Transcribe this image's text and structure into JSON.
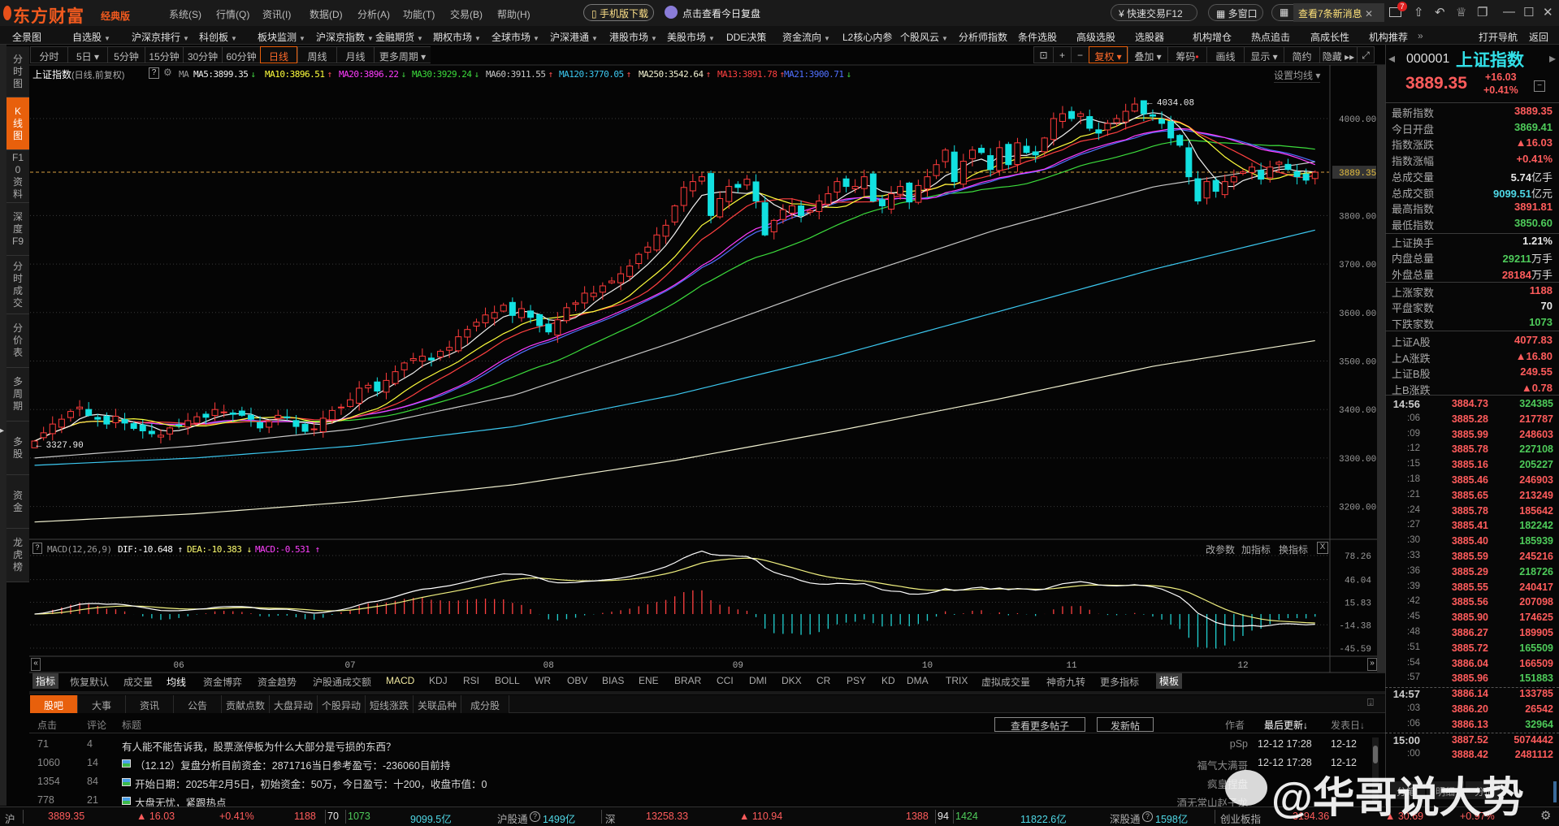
{
  "app": {
    "logo": "东方财富",
    "edition": "经典版",
    "menu": [
      "系统(S)",
      "行情(Q)",
      "资讯(I)",
      "数据(D)",
      "分析(A)",
      "功能(T)",
      "交易(B)",
      "帮助(H)"
    ],
    "mobile_download": "手机版下载",
    "daily_review": "点击查看今日复盘",
    "quick_trade": "快速交易F12",
    "multi_window": "多窗口",
    "new_messages": "查看7条新消息",
    "message_badge": "7"
  },
  "nav": {
    "items": [
      {
        "label": "全景图",
        "dropdown": false
      },
      {
        "label": "自选股",
        "dropdown": true
      },
      {
        "label": "沪深京排行",
        "dropdown": true
      },
      {
        "label": "科创板",
        "dropdown": true
      },
      {
        "label": "板块监测",
        "dropdown": true
      },
      {
        "label": "沪深京指数",
        "dropdown": true
      },
      {
        "label": "金融期货",
        "dropdown": true
      },
      {
        "label": "期权市场",
        "dropdown": true
      },
      {
        "label": "全球市场",
        "dropdown": true
      },
      {
        "label": "沪深港通",
        "dropdown": true
      },
      {
        "label": "港股市场",
        "dropdown": true
      },
      {
        "label": "美股市场",
        "dropdown": true
      },
      {
        "label": "DDE决策",
        "dropdown": false
      },
      {
        "label": "资金流向",
        "dropdown": true
      },
      {
        "label": "L2核心内参",
        "dropdown": false
      },
      {
        "label": "个股风云",
        "dropdown": true
      },
      {
        "label": "分析师指数",
        "dropdown": false
      },
      {
        "label": "条件选股",
        "dropdown": false
      },
      {
        "label": "高级选股",
        "dropdown": false
      },
      {
        "label": "选股器",
        "dropdown": false
      },
      {
        "label": "机构增仓",
        "dropdown": false
      },
      {
        "label": "热点追击",
        "dropdown": false
      },
      {
        "label": "高成长性",
        "dropdown": false
      },
      {
        "label": "机构推荐",
        "dropdown": false
      }
    ],
    "more": "»",
    "open_nav": "打开导航",
    "back": "返回"
  },
  "sidebar": [
    "分时图",
    "K线图",
    "F10资料",
    "深度F9",
    "分时成交",
    "分价表",
    "多周期",
    "多股",
    "资金",
    "龙虎榜"
  ],
  "sidebar_active": 1,
  "periods": {
    "items": [
      "分时",
      "5日 ▾",
      "5分钟",
      "15分钟",
      "30分钟",
      "60分钟",
      "日线",
      "周线",
      "月线",
      "更多周期 ▾"
    ],
    "active": 6
  },
  "toolbar": {
    "items": [
      "复权 ▾",
      "叠加 ▾",
      "筹码",
      "画线",
      "显示 ▾",
      "简约",
      "隐藏 ▸▸"
    ],
    "active": 0
  },
  "legend": {
    "name": "上证指数",
    "mode": "(日线,前复权)",
    "help": "?",
    "ma_label": "MA",
    "items": [
      {
        "label": "MA5:3899.35",
        "arrow": "↓",
        "color": "#f0f0f0"
      },
      {
        "label": "MA10:3896.51",
        "arrow": "↑",
        "color": "#ffff3c"
      },
      {
        "label": "MA20:3896.22",
        "arrow": "↓",
        "color": "#ff3cff"
      },
      {
        "label": "MA30:3929.24",
        "arrow": "↓",
        "color": "#3cdc3c"
      },
      {
        "label": "MA60:3911.55",
        "arrow": "↑",
        "color": "#c8c8c8"
      },
      {
        "label": "MA120:3770.05",
        "arrow": "↑",
        "color": "#3cc8f0"
      },
      {
        "label": "MA250:3542.64",
        "arrow": "↑",
        "color": "#f0f0d0"
      },
      {
        "label": "MA13:3891.78",
        "arrow": "↑",
        "color": "#ff4040"
      },
      {
        "label": "MA21:3900.71",
        "arrow": "↓",
        "color": "#5070ff"
      }
    ],
    "set_ma": "设置均线 ▾"
  },
  "chart_data": {
    "type": "candlestick",
    "title": "上证指数 日线",
    "close": [
      3335,
      3352,
      3370,
      3380,
      3396,
      3405,
      3388,
      3380,
      3370,
      3386,
      3372,
      3361,
      3356,
      3350,
      3347,
      3362,
      3368,
      3377,
      3385,
      3384,
      3400,
      3395,
      3390,
      3388,
      3380,
      3362,
      3375,
      3388,
      3383,
      3365,
      3355,
      3360,
      3382,
      3398,
      3405,
      3420,
      3444,
      3450,
      3438,
      3460,
      3478,
      3496,
      3505,
      3510,
      3502,
      3520,
      3528,
      3550,
      3565,
      3580,
      3595,
      3600,
      3615,
      3594,
      3608,
      3590,
      3573,
      3560,
      3585,
      3610,
      3620,
      3640,
      3640,
      3655,
      3665,
      3680,
      3696,
      3720,
      3735,
      3760,
      3780,
      3820,
      3858,
      3870,
      3880,
      3800,
      3835,
      3860,
      3858,
      3875,
      3830,
      3760,
      3790,
      3812,
      3820,
      3800,
      3810,
      3830,
      3845,
      3870,
      3860,
      3860,
      3880,
      3830,
      3820,
      3845,
      3860,
      3828,
      3862,
      3880,
      3905,
      3935,
      3870,
      3912,
      3935,
      3930,
      3895,
      3940,
      3905,
      3950,
      3930,
      3925,
      3960,
      4000,
      4010,
      4000,
      4010,
      3980,
      3970,
      3990,
      4000,
      4015,
      4030,
      4010,
      4005,
      3990,
      3960,
      3945,
      3880,
      3830,
      3870,
      3850,
      3870,
      3880,
      3890,
      3900,
      3875,
      3900,
      3910,
      3895,
      3880,
      3873,
      3889.35
    ],
    "ma_sampled": {
      "MA60": [
        3300,
        3325,
        3360,
        3430,
        3540,
        3660,
        3770,
        3860,
        3911
      ],
      "MA120": [
        3285,
        3300,
        3325,
        3365,
        3430,
        3510,
        3600,
        3690,
        3770
      ],
      "MA250": [
        3168,
        3185,
        3210,
        3245,
        3295,
        3355,
        3420,
        3490,
        3542
      ]
    },
    "ma_colors": {
      "MA5": "#f0f0f0",
      "MA10": "#ffff3c",
      "MA20": "#ff3cff",
      "MA30": "#3cdc3c",
      "MA13": "#ff4040",
      "MA21": "#5070ff",
      "MA60": "#c8c8c8",
      "MA120": "#3cc8f0",
      "MA250": "#f0f0d0"
    },
    "y_ticks": [
      "4000.00",
      "3800.00",
      "3700.00",
      "3600.00",
      "3500.00",
      "3400.00",
      "3300.00",
      "3200.00"
    ],
    "ylim": [
      3130,
      4090
    ],
    "last_price": "3889.35",
    "high_marker": {
      "label": "4034.08",
      "value": 4034.08,
      "index": 123
    },
    "low_marker": {
      "label": "3327.90",
      "value": 3327.9,
      "index": 0
    },
    "months": [
      {
        "label": "06",
        "index": 16
      },
      {
        "label": "07",
        "index": 35
      },
      {
        "label": "08",
        "index": 57
      },
      {
        "label": "09",
        "index": 78
      },
      {
        "label": "10",
        "index": 99
      },
      {
        "label": "11",
        "index": 115
      },
      {
        "label": "12",
        "index": 134
      }
    ],
    "up_color": "#ff3b3b",
    "down_color": "#12e0e0",
    "macd": {
      "title": "MACD(12,26,9)",
      "dif": "DIF:-10.648 ↑",
      "dea": "DEA:-10.383 ↓",
      "macd": "MACD:-0.531 ↑",
      "y_ticks": [
        "78.26",
        "46.04",
        "15.83",
        "-14.38",
        "-45.59"
      ],
      "ylim": [
        -45.59,
        78.26
      ]
    }
  },
  "indicator_header": {
    "edit": "改参数",
    "add": "加指标",
    "switch": "换指标",
    "close": "X"
  },
  "indicator_tabs": [
    "指标",
    "恢复默认",
    "成交量",
    "均线",
    "资金博弈",
    "资金趋势",
    "沪股通成交额",
    "MACD",
    "KDJ",
    "RSI",
    "BOLL",
    "WR",
    "OBV",
    "BIAS",
    "ENE",
    "BRAR",
    "CCI",
    "DMI",
    "DKX",
    "CR",
    "PSY",
    "KD",
    "DMA",
    "TRIX",
    "虚拟成交量",
    "神奇九转",
    "更多指标",
    "模板"
  ],
  "bottom_tabs": [
    "股吧",
    "大事",
    "资讯",
    "公告",
    "贡献点数",
    "大盘异动",
    "个股异动",
    "短线涨跌",
    "关联品种",
    "成分股"
  ],
  "posts_header": {
    "clicks": "点击",
    "comments": "评论",
    "title": "标题",
    "more_posts": "查看更多帖子",
    "new_post": "发新帖",
    "author": "作者",
    "updated": "最后更新↓",
    "date": "发表日↓"
  },
  "posts": [
    {
      "clicks": "71",
      "comments": "4",
      "title": "有人能不能告诉我，股票涨停板为什么大部分是亏损的东西？",
      "image": false,
      "author": "pSp",
      "updated": "12-12 17:28",
      "date": "12-12"
    },
    {
      "clicks": "1060",
      "comments": "14",
      "title": "（12.12）复盘分析目前资金：2871716当日参考盈亏：-236060目前持",
      "image": true,
      "author": "福气大满哥",
      "updated": "12-12 17:28",
      "date": "12-12"
    },
    {
      "clicks": "1354",
      "comments": "84",
      "title": "开始日期：2025年2月5日，初始资金：50万，今日盈亏：十200，收盘市值：0",
      "image": true,
      "author": "疯皇捏盘",
      "updated": "",
      "date": ""
    },
    {
      "clicks": "778",
      "comments": "21",
      "title": "大盘无忧，紧跟热点",
      "image": true,
      "author": "酒无常山赵子龙",
      "updated": "",
      "date": ""
    }
  ],
  "quote": {
    "code": "000001",
    "name": "上证指数",
    "price": "3889.35",
    "change": "+16.03",
    "change_pct": "+0.41%",
    "rows": [
      {
        "label": "最新指数",
        "value": "3889.35",
        "unit": "",
        "color": "red"
      },
      {
        "label": "今日开盘",
        "value": "3869.41",
        "unit": "",
        "color": "green"
      },
      {
        "label": "指数涨跌",
        "value": "▲16.03",
        "unit": "",
        "color": "red"
      },
      {
        "label": "指数涨幅",
        "value": "+0.41%",
        "unit": "",
        "color": "red"
      },
      {
        "label": "总成交量",
        "value": "5.74",
        "unit": "亿手",
        "color": "white"
      },
      {
        "label": "总成交额",
        "value": "9099.51",
        "unit": "亿元",
        "color": "cyan"
      },
      {
        "label": "最高指数",
        "value": "3891.81",
        "unit": "",
        "color": "red"
      },
      {
        "label": "最低指数",
        "value": "3850.60",
        "unit": "",
        "color": "green"
      },
      {
        "label": "上证换手",
        "value": "1.21%",
        "unit": "",
        "color": "white"
      },
      {
        "label": "内盘总量",
        "value": "29211",
        "unit": "万手",
        "color": "green"
      },
      {
        "label": "外盘总量",
        "value": "28184",
        "unit": "万手",
        "color": "red"
      },
      {
        "label": "上涨家数",
        "value": "1188",
        "unit": "",
        "color": "red"
      },
      {
        "label": "平盘家数",
        "value": "70",
        "unit": "",
        "color": "white"
      },
      {
        "label": "下跌家数",
        "value": "1073",
        "unit": "",
        "color": "green"
      },
      {
        "label": "上证A股",
        "value": "4077.83",
        "unit": "",
        "color": "red"
      },
      {
        "label": "上A涨跌",
        "value": "▲16.80",
        "unit": "",
        "color": "red"
      },
      {
        "label": "上证B股",
        "value": "249.55",
        "unit": "",
        "color": "red"
      },
      {
        "label": "上B涨跌",
        "value": "▲0.78",
        "unit": "",
        "color": "red"
      }
    ],
    "ticks": [
      {
        "t": "14:56",
        "p": "3884.73",
        "v": "324385",
        "vc": "green"
      },
      {
        "t": ":06",
        "p": "3885.28",
        "v": "217787",
        "vc": "red"
      },
      {
        "t": ":09",
        "p": "3885.99",
        "v": "248603",
        "vc": "red"
      },
      {
        "t": ":12",
        "p": "3885.78",
        "v": "227108",
        "vc": "green"
      },
      {
        "t": ":15",
        "p": "3885.16",
        "v": "205227",
        "vc": "green"
      },
      {
        "t": ":18",
        "p": "3885.46",
        "v": "246903",
        "vc": "red"
      },
      {
        "t": ":21",
        "p": "3885.65",
        "v": "213249",
        "vc": "red"
      },
      {
        "t": ":24",
        "p": "3885.78",
        "v": "185642",
        "vc": "red"
      },
      {
        "t": ":27",
        "p": "3885.41",
        "v": "182242",
        "vc": "green"
      },
      {
        "t": ":30",
        "p": "3885.40",
        "v": "185939",
        "vc": "green"
      },
      {
        "t": ":33",
        "p": "3885.59",
        "v": "245216",
        "vc": "red"
      },
      {
        "t": ":36",
        "p": "3885.29",
        "v": "218726",
        "vc": "green"
      },
      {
        "t": ":39",
        "p": "3885.55",
        "v": "240417",
        "vc": "red"
      },
      {
        "t": ":42",
        "p": "3885.56",
        "v": "207098",
        "vc": "red"
      },
      {
        "t": ":45",
        "p": "3885.90",
        "v": "174625",
        "vc": "red"
      },
      {
        "t": ":48",
        "p": "3886.27",
        "v": "189905",
        "vc": "red"
      },
      {
        "t": ":51",
        "p": "3885.72",
        "v": "165509",
        "vc": "green"
      },
      {
        "t": ":54",
        "p": "3886.04",
        "v": "166509",
        "vc": "red"
      },
      {
        "t": ":57",
        "p": "3885.96",
        "v": "151883",
        "vc": "green"
      },
      {
        "t": "14:57",
        "p": "3886.14",
        "v": "133785",
        "vc": "red"
      },
      {
        "t": ":03",
        "p": "3886.20",
        "v": "26542",
        "vc": "red"
      },
      {
        "t": ":06",
        "p": "3886.13",
        "v": "32964",
        "vc": "green"
      },
      {
        "t": "15:00",
        "p": "3887.52",
        "v": "5074442",
        "vc": "red"
      },
      {
        "t": ":00",
        "p": "3888.42",
        "v": "2481112",
        "vc": "red"
      }
    ],
    "tabs": [
      "分笔",
      "明细",
      "分价"
    ]
  },
  "statusbar": {
    "sh_label": "沪",
    "sh_price": "3889.35",
    "sh_change": "▲ 16.03",
    "sh_pct": "+0.41%",
    "sh_up": "1188",
    "sh_flat": "70",
    "sh_down": "1073",
    "sh_amount": "9099.5亿",
    "hsgt_label": "沪股通",
    "hsgt_value": "1499亿",
    "sz_label": "深",
    "sz_price": "13258.33",
    "sz_change": "▲ 110.94",
    "sz_up": "1388",
    "sz_flat": "94",
    "sz_down": "1424",
    "sz_amount": "11822.6亿",
    "sgt_label": "深股通",
    "sgt_value": "1598亿",
    "cyb_label": "创业板指",
    "cyb_price": "3194.36",
    "cyb_change": "▲ 30.69",
    "cyb_pct": "+0.97%"
  },
  "watermark": "@华哥说大势"
}
